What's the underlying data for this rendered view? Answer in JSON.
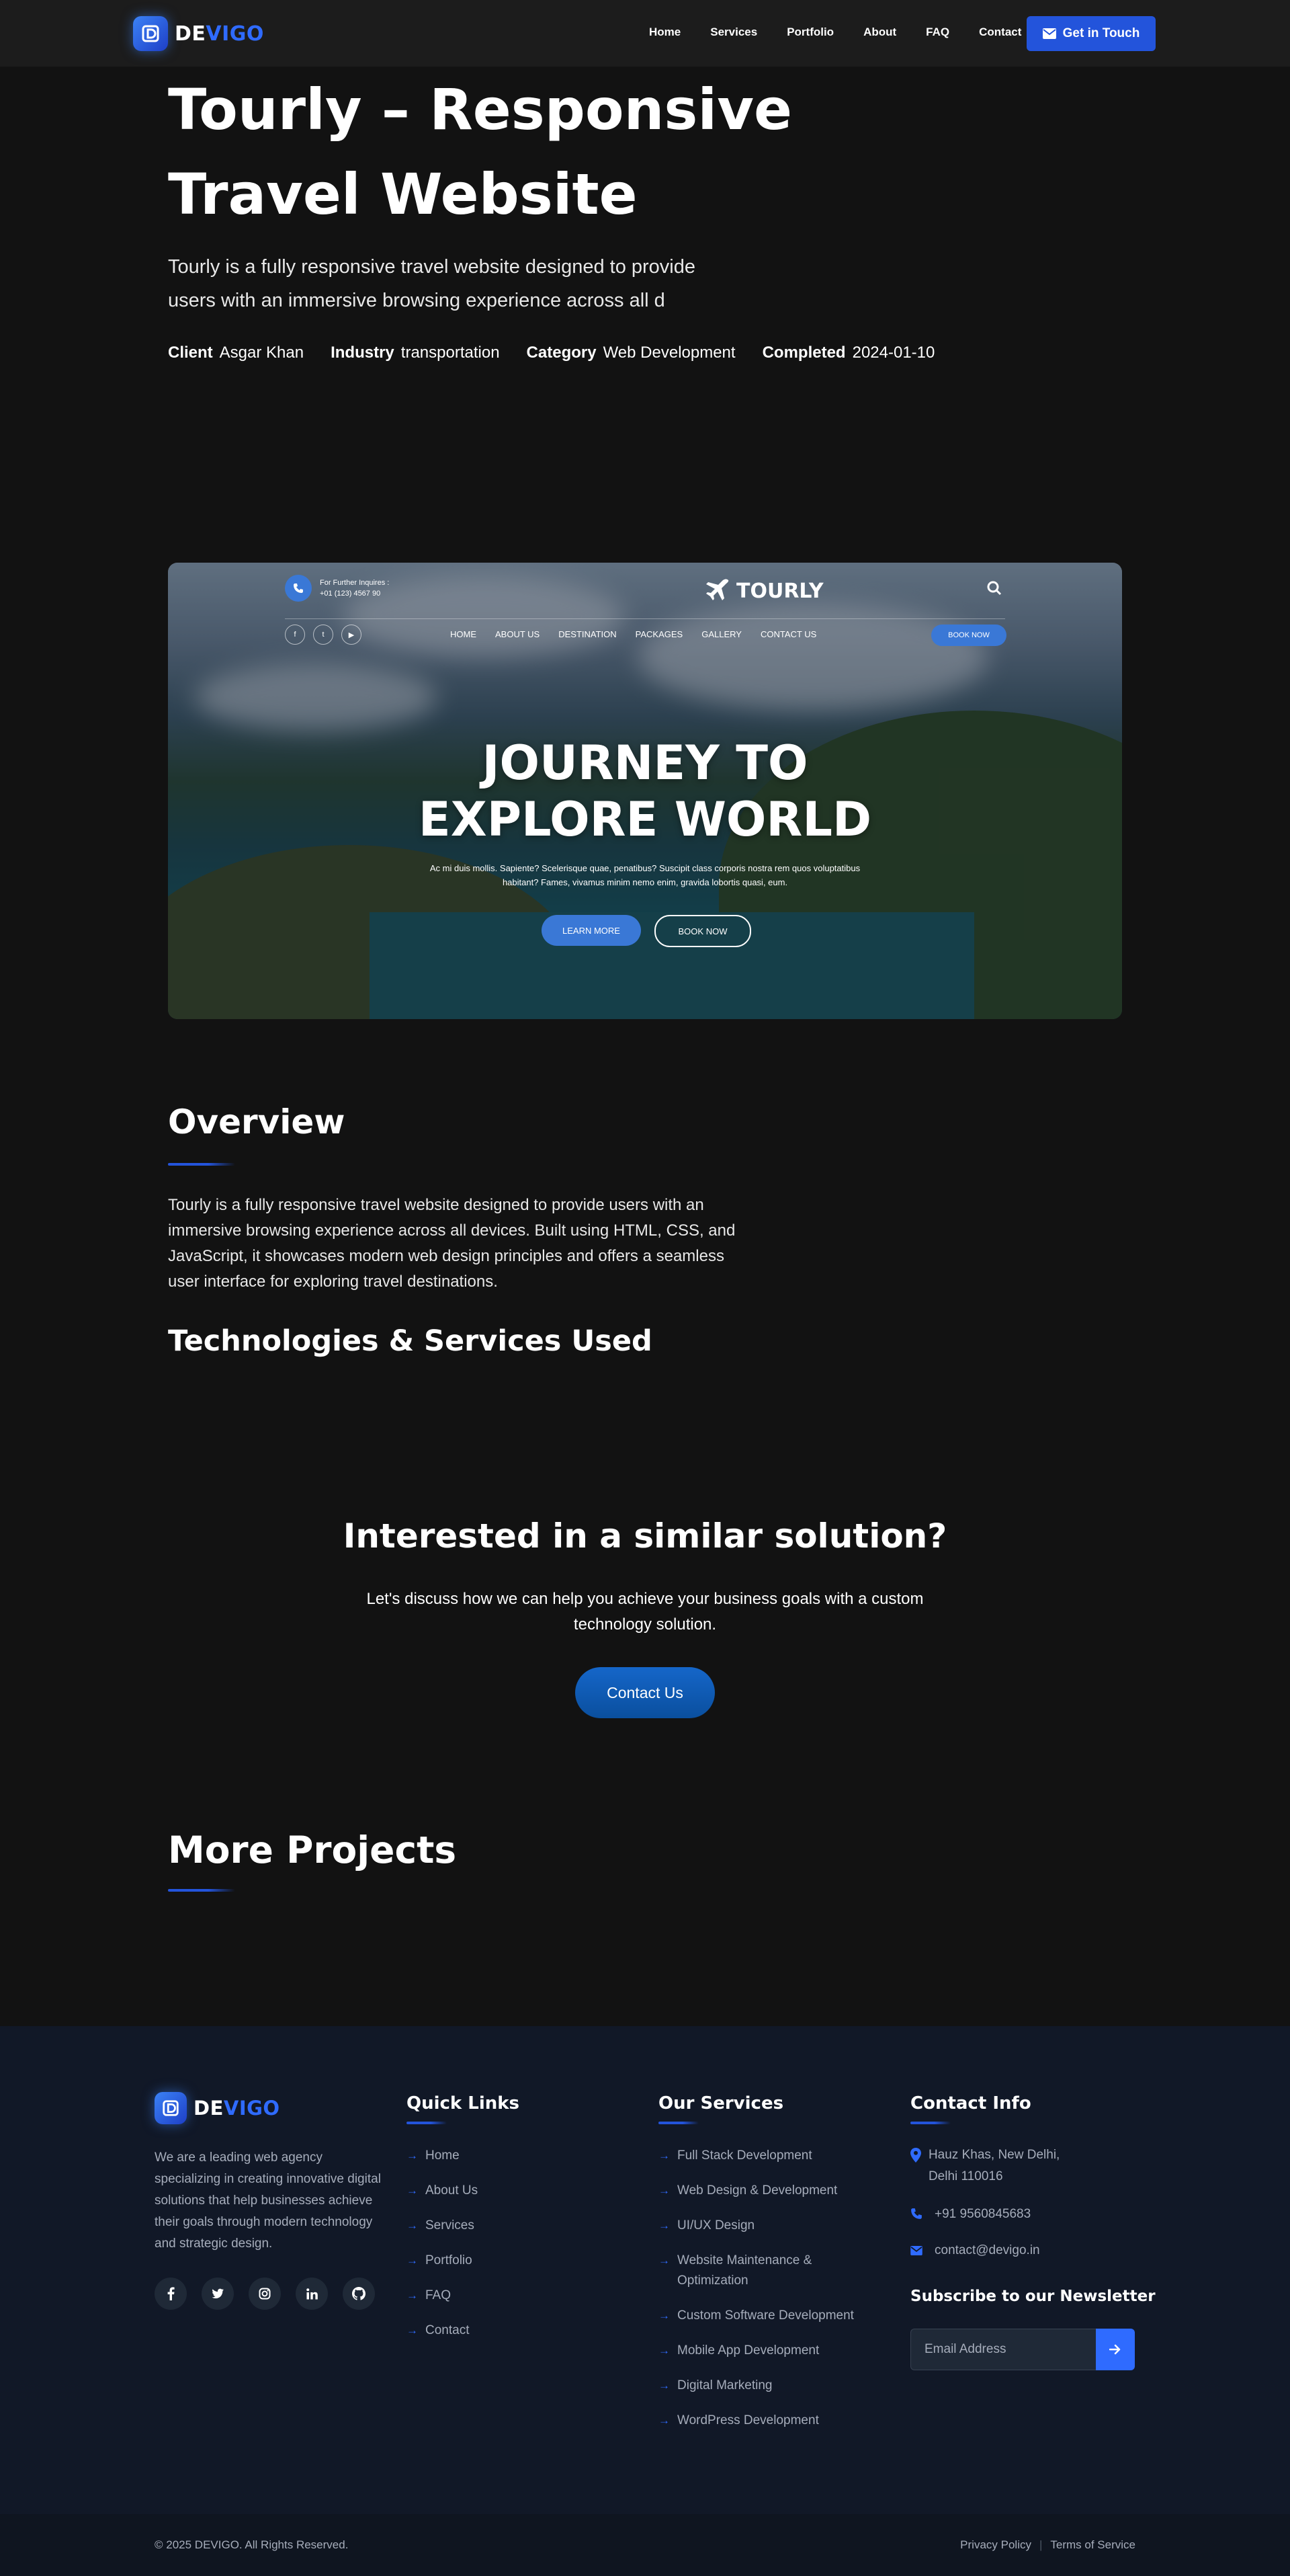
{
  "nav": {
    "brand_prefix": "DE",
    "brand_suffix": "VIGO",
    "links": [
      "Home",
      "Services",
      "Portfolio",
      "About",
      "FAQ",
      "Contact"
    ],
    "cta_label": "Get in Touch"
  },
  "project": {
    "title": "Tourly – Responsive Travel Website",
    "lead": "Tourly is a fully responsive travel website designed to provide users with an immersive browsing experience across all d",
    "meta": [
      {
        "label": "Client",
        "value": "Asgar Khan"
      },
      {
        "label": "Industry",
        "value": "transportation"
      },
      {
        "label": "Category",
        "value": "Web Development"
      },
      {
        "label": "Completed",
        "value": "2024-01-10"
      }
    ]
  },
  "preview": {
    "phone_label": "For Further Inquires :",
    "phone_number": "+01 (123) 4567 90",
    "logo": "TOURLY",
    "social": [
      "f",
      "t",
      "▶"
    ],
    "menu": [
      "HOME",
      "ABOUT US",
      "DESTINATION",
      "PACKAGES",
      "GALLERY",
      "CONTACT US"
    ],
    "book_label": "BOOK NOW",
    "headline_1": "JOURNEY TO",
    "headline_2": "EXPLORE WORLD",
    "subtext": "Ac mi duis mollis. Sapiente? Scelerisque quae, penatibus? Suscipit class corporis nostra rem quos voluptatibus habitant? Fames, vivamus minim nemo enim, gravida lobortis quasi, eum.",
    "learn_more": "LEARN MORE",
    "book_now": "BOOK NOW"
  },
  "overview": {
    "title": "Overview",
    "body": "Tourly is a fully responsive travel website designed to provide users with an immersive browsing experience across all devices. Built using HTML, CSS, and JavaScript, it showcases modern web design principles and offers a seamless user interface for exploring travel destinations.",
    "tech_title": "Technologies & Services Used"
  },
  "cta": {
    "title": "Interested in a similar solution?",
    "text": "Let's discuss how we can help you achieve your business goals with a custom technology solution.",
    "button": "Contact Us"
  },
  "more_projects": {
    "title": "More Projects"
  },
  "footer": {
    "about": "We are a leading web agency specializing in creating innovative digital solutions that help businesses achieve their goals through modern technology and strategic design.",
    "social_icons": [
      "facebook-icon",
      "twitter-icon",
      "instagram-icon",
      "linkedin-icon",
      "github-icon"
    ],
    "quick_links_title": "Quick Links",
    "quick_links": [
      "Home",
      "About Us",
      "Services",
      "Portfolio",
      "FAQ",
      "Contact"
    ],
    "services_title": "Our Services",
    "services": [
      "Full Stack Development",
      "Web Design & Development",
      "UI/UX Design",
      "Website Maintenance & Optimization",
      "Custom Software Development",
      "Mobile App Development",
      "Digital Marketing",
      "WordPress Development"
    ],
    "contact_title": "Contact Info",
    "address": "Hauz Khas, New Delhi, Delhi 110016",
    "phone": "+91 9560845683",
    "email": "contact@devigo.in",
    "newsletter_title": "Subscribe to our Newsletter",
    "email_placeholder": "Email Address",
    "copyright": "© 2025 DEVIGO. All Rights Reserved.",
    "privacy": "Privacy Policy",
    "terms": "Terms of Service"
  },
  "colors": {
    "accent": "#2354db",
    "brand_blue": "#2f6bff",
    "background": "#121212",
    "footer_bg": "#111827"
  }
}
